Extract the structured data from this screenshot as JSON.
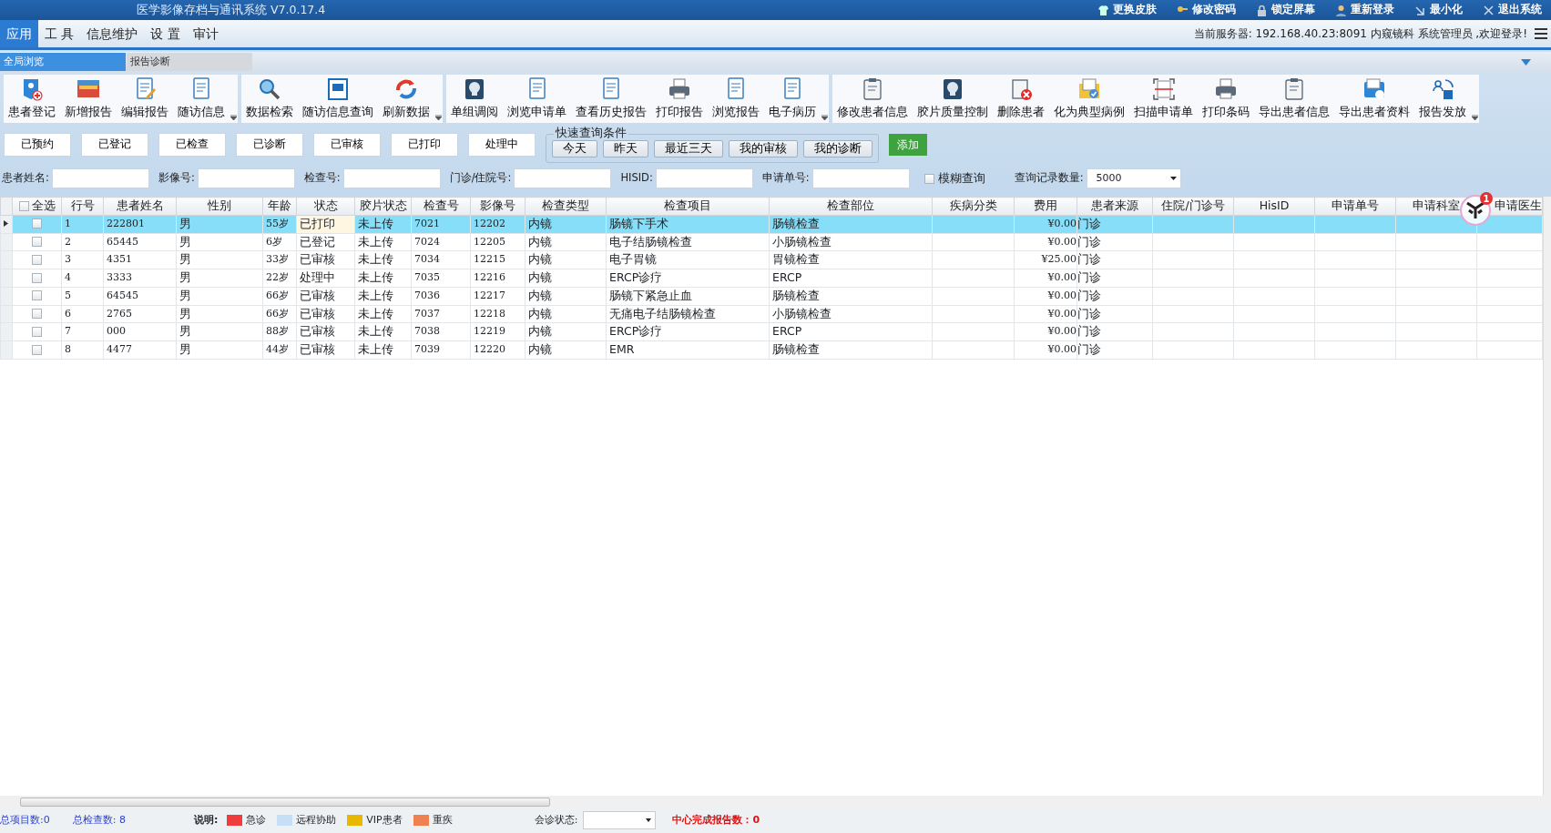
{
  "window": {
    "title": "医学影像存档与通讯系统 V7.0.17.4"
  },
  "title_actions": [
    {
      "label": "更换皮肤"
    },
    {
      "label": "修改密码"
    },
    {
      "label": "锁定屏幕"
    },
    {
      "label": "重新登录"
    },
    {
      "label": "最小化"
    },
    {
      "label": "退出系统"
    }
  ],
  "menu": [
    {
      "label": "应用",
      "selected": true
    },
    {
      "label": "工 具",
      "selected": false
    },
    {
      "label": "信息维护",
      "selected": false
    },
    {
      "label": "设 置",
      "selected": false
    },
    {
      "label": "审计",
      "selected": false
    }
  ],
  "server_info": "当前服务器: 192.168.40.23:8091 内窥镜科 系统管理员 ,欢迎登录!",
  "view_tabs": [
    {
      "label": "全局浏览",
      "selected": true
    },
    {
      "label": "报告诊断",
      "selected": false
    }
  ],
  "toolbar_groups": [
    {
      "items": [
        "患者登记",
        "新增报告",
        "编辑报告",
        "随访信息"
      ]
    },
    {
      "items": [
        "数据检索",
        "随访信息查询",
        "刷新数据"
      ]
    },
    {
      "items": [
        "单组调阅",
        "浏览申请单",
        "查看历史报告",
        "打印报告",
        "浏览报告",
        "电子病历"
      ]
    },
    {
      "items": [
        "修改患者信息",
        "胶片质量控制",
        "删除患者",
        "化为典型病例",
        "扫描申请单",
        "打印条码",
        "导出患者信息",
        "导出患者资料",
        "报告发放"
      ]
    }
  ],
  "status_buttons": [
    "已预约",
    "已登记",
    "已检查",
    "已诊断",
    "已审核",
    "已打印",
    "处理中"
  ],
  "quick_query": {
    "title": "快速查询条件",
    "buttons": [
      "今天",
      "昨天",
      "最近三天",
      "我的审核",
      "我的诊断"
    ]
  },
  "add_button": "添加",
  "filters": [
    {
      "kind": "text",
      "label": "患者姓名:"
    },
    {
      "kind": "text",
      "label": "影像号:"
    },
    {
      "kind": "text",
      "label": "检查号:"
    },
    {
      "kind": "text",
      "label": "门诊/住院号:"
    },
    {
      "kind": "text",
      "label": "HISID:"
    },
    {
      "kind": "text",
      "label": "申请单号:"
    },
    {
      "kind": "checkbox",
      "label": "模糊查询",
      "checked": false
    },
    {
      "kind": "select",
      "label": "查询记录数量:",
      "value": "5000"
    }
  ],
  "table": {
    "select_all": {
      "label": "全选",
      "checked": false
    },
    "columns": [
      "行号",
      "患者姓名",
      "性别",
      "年龄",
      "状态",
      "胶片状态",
      "检查号",
      "影像号",
      "检查类型",
      "检查项目",
      "检查部位",
      "疾病分类",
      "费用",
      "患者来源",
      "住院/门诊号",
      "HisID",
      "申请单号",
      "申请科室",
      "申请医生"
    ],
    "rows": [
      {
        "selected": true,
        "checked": false,
        "status_focused": true,
        "cells": [
          "1",
          "222801",
          "男",
          "55岁",
          "已打印",
          "未上传",
          "7021",
          "12202",
          "内镜",
          "肠镜下手术",
          "肠镜检查",
          null,
          "¥0.00",
          "门诊"
        ]
      },
      {
        "selected": false,
        "checked": false,
        "status_focused": false,
        "cells": [
          "2",
          "65445",
          "男",
          "6岁",
          "已登记",
          "未上传",
          "7024",
          "12205",
          "内镜",
          "电子结肠镜检查",
          "小肠镜检查",
          null,
          "¥0.00",
          "门诊"
        ]
      },
      {
        "selected": false,
        "checked": false,
        "status_focused": false,
        "cells": [
          "3",
          "4351",
          "男",
          "33岁",
          "已审核",
          "未上传",
          "7034",
          "12215",
          "内镜",
          "电子胃镜",
          "胃镜检查",
          null,
          "¥25.00",
          "门诊"
        ]
      },
      {
        "selected": false,
        "checked": false,
        "status_focused": false,
        "cells": [
          "4",
          "3333",
          "男",
          "22岁",
          "处理中",
          "未上传",
          "7035",
          "12216",
          "内镜",
          "ERCP诊疗",
          "ERCP",
          null,
          "¥0.00",
          "门诊"
        ]
      },
      {
        "selected": false,
        "checked": false,
        "status_focused": false,
        "cells": [
          "5",
          "64545",
          "男",
          "66岁",
          "已审核",
          "未上传",
          "7036",
          "12217",
          "内镜",
          "肠镜下紧急止血",
          "肠镜检查",
          null,
          "¥0.00",
          "门诊"
        ]
      },
      {
        "selected": false,
        "checked": false,
        "status_focused": false,
        "cells": [
          "6",
          "2765",
          "男",
          "66岁",
          "已审核",
          "未上传",
          "7037",
          "12218",
          "内镜",
          "无痛电子结肠镜检查",
          "小肠镜检查",
          null,
          "¥0.00",
          "门诊"
        ]
      },
      {
        "selected": false,
        "checked": false,
        "status_focused": false,
        "cells": [
          "7",
          "000",
          "男",
          "88岁",
          "已审核",
          "未上传",
          "7038",
          "12219",
          "内镜",
          "ERCP诊疗",
          "ERCP",
          null,
          "¥0.00",
          "门诊"
        ]
      },
      {
        "selected": false,
        "checked": false,
        "status_focused": false,
        "cells": [
          "8",
          "4477",
          "男",
          "44岁",
          "已审核",
          "未上传",
          "7039",
          "12220",
          "内镜",
          "EMR",
          "肠镜检查",
          null,
          "¥0.00",
          "门诊"
        ]
      }
    ]
  },
  "floating_widget": {
    "badge": "1"
  },
  "status_bar": {
    "total_items": "总项目数:0",
    "total_exams": "总检查数: 8",
    "legend_title": "说明:",
    "legend": [
      {
        "label": "急诊",
        "color": "#f03c3c"
      },
      {
        "label": "远程协助",
        "color": "#c6def6"
      },
      {
        "label": "VIP患者",
        "color": "#e8b800"
      },
      {
        "label": "重疾",
        "color": "#f08050"
      }
    ],
    "consult_label": "会诊状态:",
    "center_reports": "中心完成报告数：0"
  }
}
